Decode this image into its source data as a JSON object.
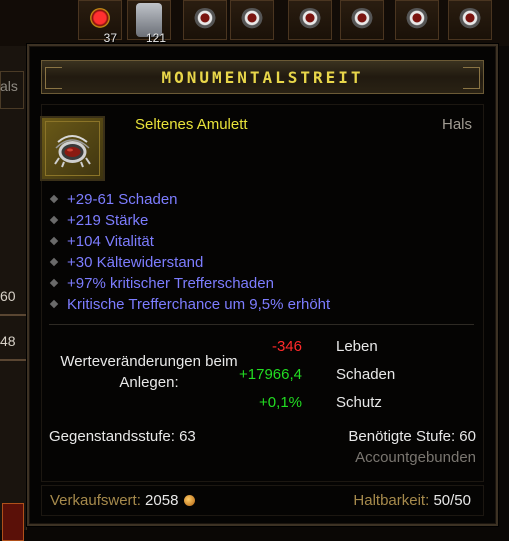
{
  "background": {
    "belt_slots": [
      {
        "kind": "potion",
        "count": "37"
      },
      {
        "kind": "scroll",
        "count": "121"
      },
      {
        "kind": "amulet",
        "count": ""
      },
      {
        "kind": "amulet",
        "count": ""
      },
      {
        "kind": "amulet",
        "count": ""
      },
      {
        "kind": "amulet",
        "count": ""
      },
      {
        "kind": "amulet",
        "count": ""
      },
      {
        "kind": "amulet",
        "count": ""
      }
    ],
    "left_panel": {
      "label": "als",
      "value1": "60",
      "value2": "48"
    }
  },
  "item": {
    "name": "MONUMENTALSTREIT",
    "type": "Seltenes Amulett",
    "slot": "Hals",
    "icon": "amulet-icon",
    "affixes": [
      "+29-61 Schaden",
      "+219 Stärke",
      "+104 Vitalität",
      "+30 Kältewiderstand",
      "+97% kritischer Trefferschaden",
      "Kritische Trefferchance um 9,5% erhöht"
    ],
    "stat_changes": {
      "label": "Werteveränderungen beim Anlegen:",
      "rows": [
        {
          "delta": "-346",
          "name": "Leben",
          "color": "#ff2a2a"
        },
        {
          "delta": "+17966,4",
          "name": "Schaden",
          "color": "#22dd22"
        },
        {
          "delta": "+0,1%",
          "name": "Schutz",
          "color": "#22dd22"
        }
      ]
    },
    "item_level": "Gegenstandsstufe: 63",
    "required_level": "Benötigte Stufe: 60",
    "binding": "Accountgebunden",
    "sell_label": "Verkaufswert:",
    "sell_value": "2058",
    "durability_label": "Haltbarkeit:",
    "durability_value": "50/50"
  },
  "colors": {
    "title": "#e8d64a",
    "rare": "#e8e23a",
    "magic_affix": "#7d7dff",
    "negative": "#ff2a2a",
    "positive": "#22dd22",
    "gold_label": "#a68a4c"
  }
}
